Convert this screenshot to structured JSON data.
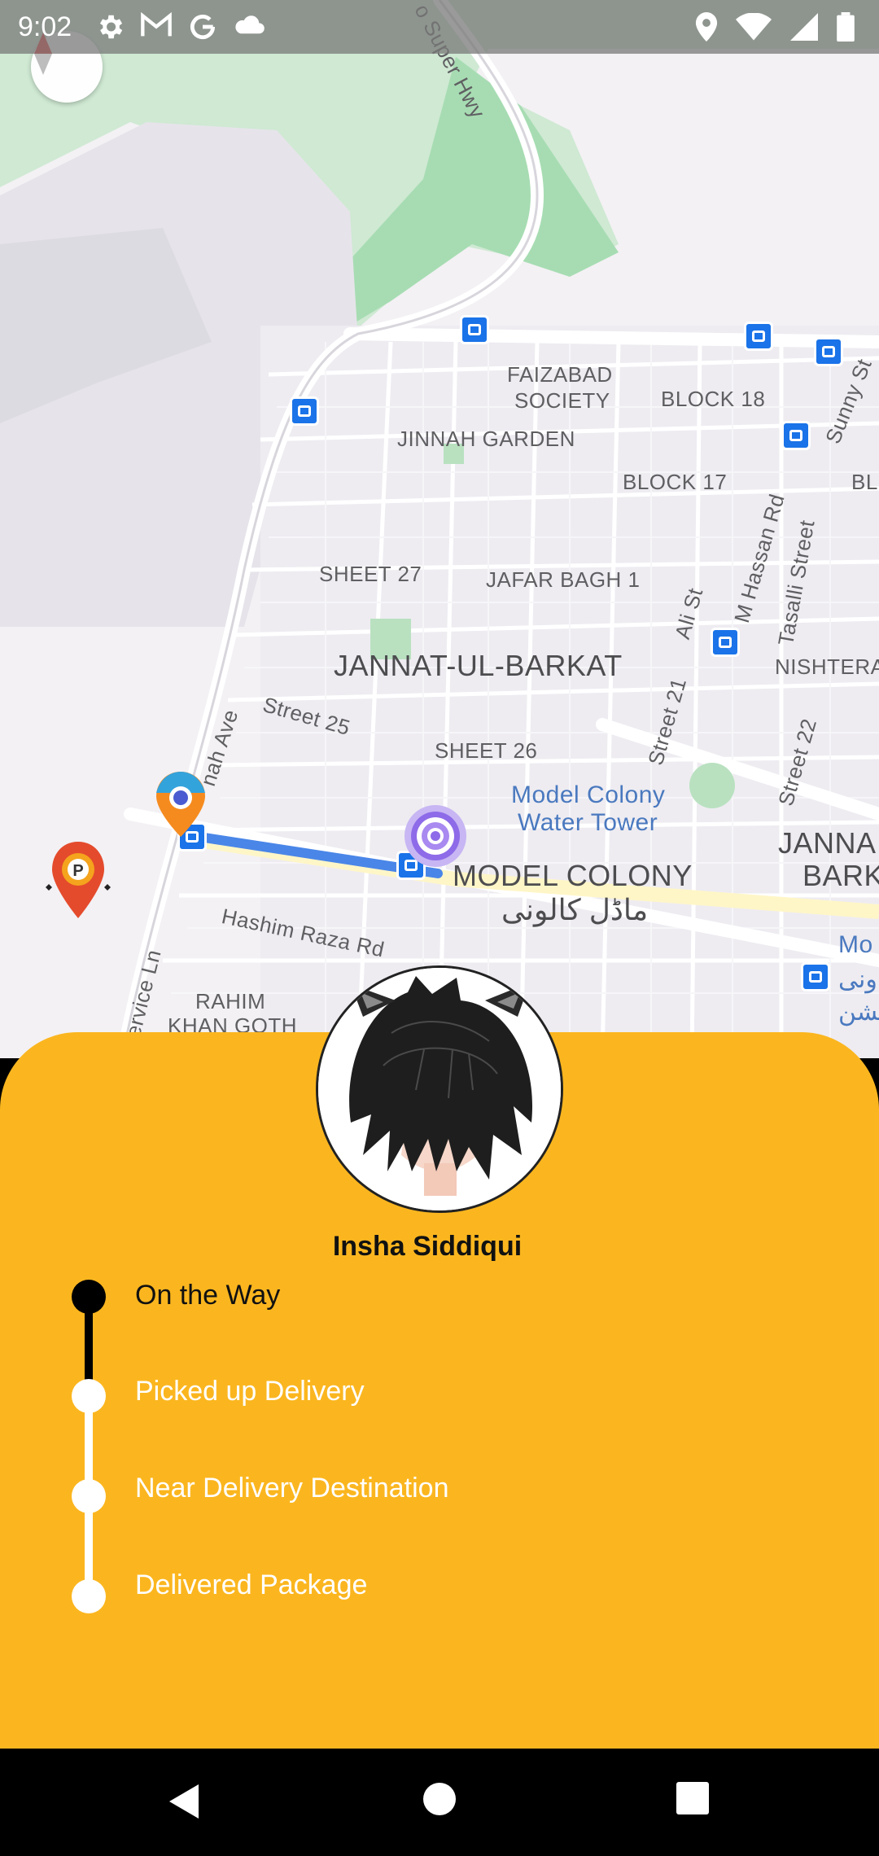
{
  "status_bar": {
    "time": "9:02",
    "left_icons": [
      "gear-icon",
      "gmail-icon",
      "google-icon",
      "cloud-icon"
    ],
    "right_icons": [
      "location-icon",
      "wifi-icon",
      "signal-icon",
      "battery-icon"
    ]
  },
  "map": {
    "labels": {
      "super_hwy": "o Super Hwy",
      "faizabad": "FAIZABAD",
      "society": "SOCIETY",
      "block18": "BLOCK 18",
      "jinnah_garden": "JINNAH GARDEN",
      "block17": "BLOCK 17",
      "bl": "BL",
      "sheet27": "SHEET 27",
      "jafar_bagh": "JAFAR BAGH 1",
      "ali_st": "Ali St",
      "m_hassan_rd": "M Hassan Rd",
      "tasalli_street": "Tasalli Street",
      "sunny_st": "Sunny St",
      "jannat_ul_barkat": "JANNAT-UL-BARKAT",
      "nishtera": "NISHTERA",
      "street25": "Street 25",
      "jinnah_ave": "nah Ave",
      "sheet26": "SHEET 26",
      "street21": "Street 21",
      "street22": "Street 22",
      "water_tower_1": "Model Colony",
      "water_tower_2": "Water Tower",
      "janna": "JANNA",
      "bark": "BARK",
      "model_colony": "MODEL COLONY",
      "model_colony_urdu": "ماڈل کالونی",
      "mo": "Mo",
      "oni": "ونی",
      "shn": "بشن",
      "hashim_raza": "Hashim Raza Rd",
      "service_ln": "ervice Ln",
      "rahim": "RAHIM",
      "khan_goth": "KHAN GOTH"
    }
  },
  "driver": {
    "name": "Insha Siddiqui"
  },
  "delivery_steps": [
    {
      "label": "On the Way",
      "active": true
    },
    {
      "label": "Picked up Delivery",
      "active": false
    },
    {
      "label": "Near Delivery Destination",
      "active": false
    },
    {
      "label": "Delivered Package",
      "active": false
    }
  ],
  "colors": {
    "panel": "#fbb61f",
    "route": "#4a86e8",
    "active_step": "#000000",
    "inactive_step": "#ffffff"
  }
}
